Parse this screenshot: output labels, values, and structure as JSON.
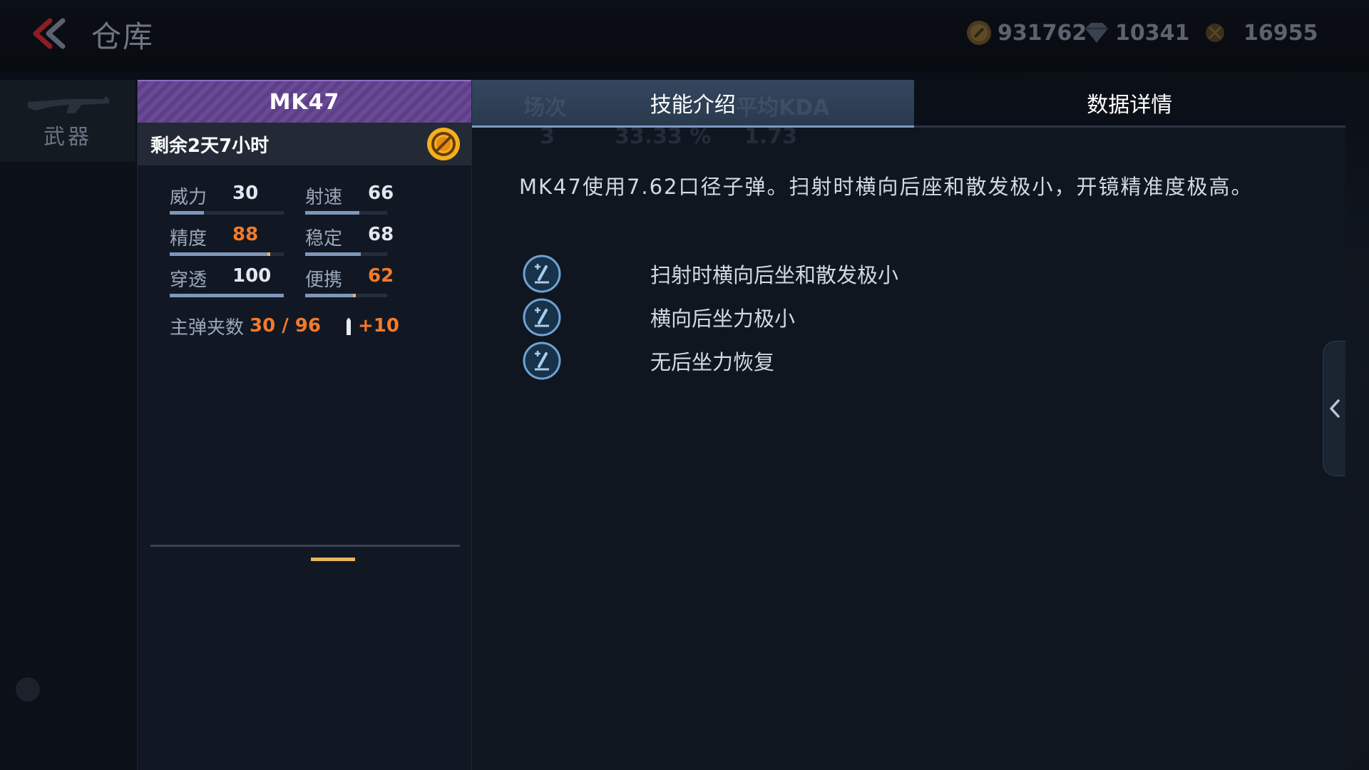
{
  "top_bar": {
    "title": "仓库",
    "currencies": [
      {
        "icon": "gold-coin-icon",
        "value": "931762"
      },
      {
        "icon": "diamond-icon",
        "value": "10341"
      },
      {
        "icon": "medal-icon",
        "value": "16955"
      }
    ]
  },
  "side_nav": {
    "active_tab": "武器"
  },
  "weapon": {
    "name": "MK47",
    "time_remaining": "剩余2天7小时",
    "stats": [
      {
        "label": "威力",
        "value": "30",
        "highlight": false,
        "fill": 0.3
      },
      {
        "label": "射速",
        "value": "66",
        "highlight": false,
        "fill": 0.66
      },
      {
        "label": "精度",
        "value": "88",
        "highlight": true,
        "fill": 0.88
      },
      {
        "label": "稳定",
        "value": "68",
        "highlight": false,
        "fill": 0.68
      },
      {
        "label": "穿透",
        "value": "100",
        "highlight": false,
        "fill": 1.0
      },
      {
        "label": "便携",
        "value": "62",
        "highlight": true,
        "fill": 0.62
      }
    ],
    "magazine_label": "主弹夹数",
    "magazine_value": "30 / 96",
    "magazine_bonus": "+10"
  },
  "tabs": [
    {
      "label": "技能介绍",
      "active": true
    },
    {
      "label": "数据详情",
      "active": false
    }
  ],
  "ghost_stats": {
    "headers": [
      "场次",
      "平均KDA"
    ],
    "values": [
      "3",
      "33.33 %",
      "1.73"
    ]
  },
  "description": "MK47使用7.62口径子弹。扫射时横向后座和散发极小，开镜精准度极高。",
  "skills": [
    "扫射时横向后坐和散发极小",
    "横向后坐力极小",
    "无后坐力恢复"
  ],
  "colors": {
    "accent_orange": "#f47a2a",
    "header_purple": "#6a4a96",
    "tab_active": "#34475e"
  }
}
